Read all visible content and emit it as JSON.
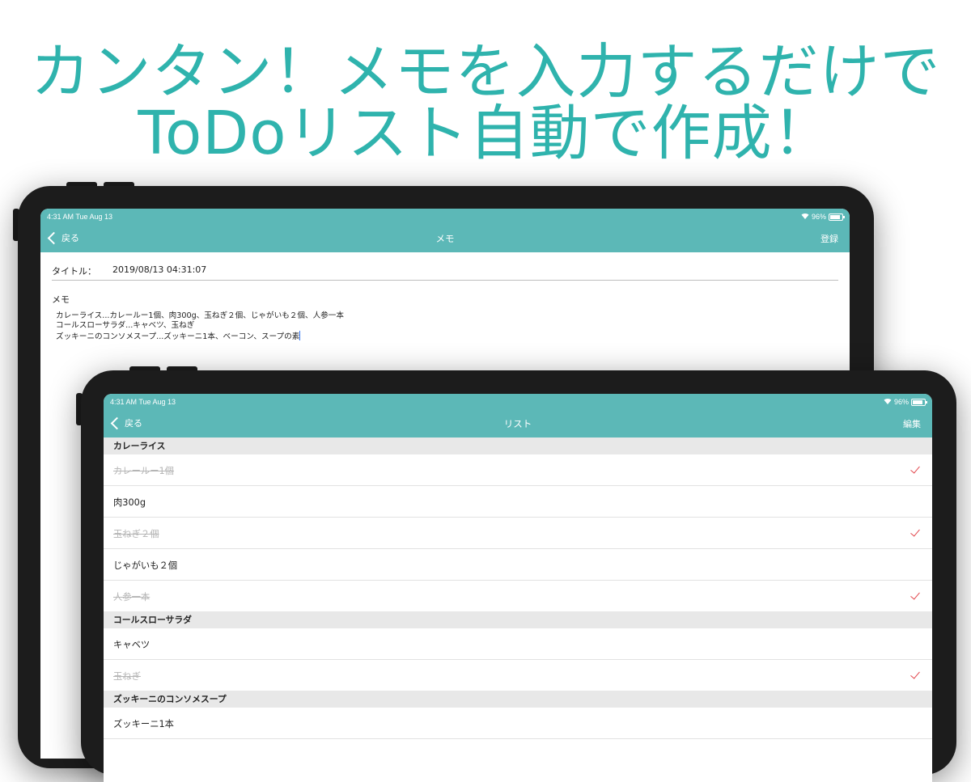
{
  "headline": {
    "line1": "カンタン！メモを入力するだけで",
    "line2": "ToDoリスト自動で作成！"
  },
  "colors": {
    "accent": "#5cb8b7",
    "headline": "#2fb3ad",
    "check": "#e2464c"
  },
  "memo_screen": {
    "status": {
      "time": "4:31 AM  Tue Aug 13",
      "battery": "96%"
    },
    "nav": {
      "back_label": "戻る",
      "title": "メモ",
      "action_label": "登録"
    },
    "title_label": "タイトル：",
    "title_value": "2019/08/13 04:31:07",
    "memo_label": "メモ",
    "memo_lines": [
      "カレーライス...カレールー1個、肉300g、玉ねぎ２個、じゃがいも２個、人参一本",
      "コールスローサラダ...キャベツ、玉ねぎ",
      "ズッキーニのコンソメスープ...ズッキーニ1本、ベーコン、スープの素"
    ]
  },
  "list_screen": {
    "status": {
      "time": "4:31 AM  Tue Aug 13",
      "battery": "96%"
    },
    "nav": {
      "back_label": "戻る",
      "title": "リスト",
      "action_label": "編集"
    },
    "sections": [
      {
        "title": "カレーライス",
        "items": [
          {
            "label": "カレールー1個",
            "done": true
          },
          {
            "label": "肉300g",
            "done": false
          },
          {
            "label": "玉ねぎ２個",
            "done": true
          },
          {
            "label": "じゃがいも２個",
            "done": false
          },
          {
            "label": "人参一本",
            "done": true
          }
        ]
      },
      {
        "title": "コールスローサラダ",
        "items": [
          {
            "label": "キャベツ",
            "done": false
          },
          {
            "label": "玉ねぎ",
            "done": true
          }
        ]
      },
      {
        "title": "ズッキーニのコンソメスープ",
        "items": [
          {
            "label": "ズッキーニ1本",
            "done": false
          }
        ]
      }
    ]
  }
}
